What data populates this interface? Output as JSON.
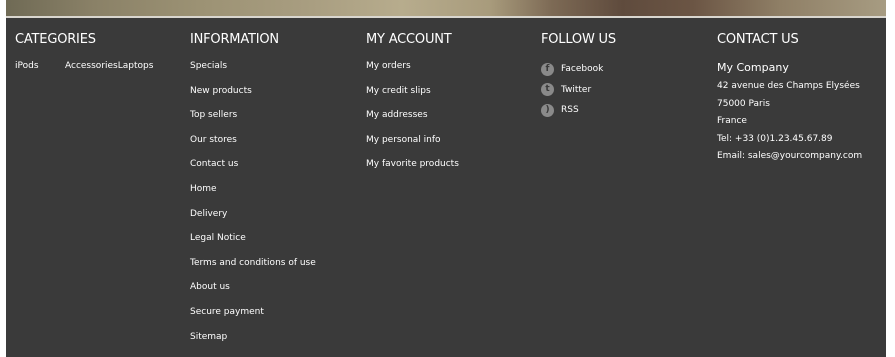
{
  "columns": {
    "categories": {
      "title": "CATEGORIES",
      "items": [
        "iPods",
        "Accessories",
        "Laptops"
      ]
    },
    "information": {
      "title": "INFORMATION",
      "items": [
        "Specials",
        "New products",
        "Top sellers",
        "Our stores",
        "Contact us",
        "Home",
        "Delivery",
        "Legal Notice",
        "Terms and conditions of use",
        "About us",
        "Secure payment",
        "Sitemap"
      ]
    },
    "my_account": {
      "title": "MY ACCOUNT",
      "items": [
        "My orders",
        "My credit slips",
        "My addresses",
        "My personal info",
        "My favorite products"
      ]
    },
    "follow_us": {
      "title": "FOLLOW US",
      "items": [
        {
          "label": "Facebook",
          "icon": "facebook-icon",
          "glyph": "f"
        },
        {
          "label": "Twitter",
          "icon": "twitter-icon",
          "glyph": "t"
        },
        {
          "label": "RSS",
          "icon": "rss-icon",
          "glyph": ")"
        }
      ]
    },
    "contact_us": {
      "title": "CONTACT US",
      "company": "My Company",
      "address_line1": "42 avenue des Champs Elysées",
      "address_line2": "75000 Paris",
      "country": "France",
      "tel": "Tel: +33 (0)1.23.45.67.89",
      "email": "Email: sales@yourcompany.com"
    }
  },
  "colors": {
    "footer_bg": "#3a3a3a",
    "text": "#ffffff",
    "icon_bg": "#8a8a8a"
  }
}
